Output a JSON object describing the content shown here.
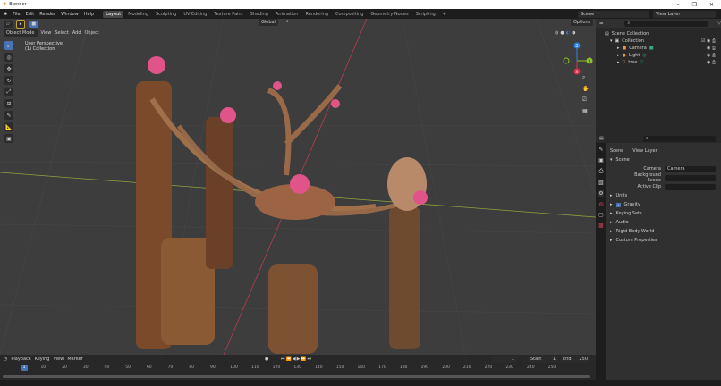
{
  "window": {
    "title": "Blender",
    "controls": [
      "–",
      "❐",
      "✕"
    ]
  },
  "menu": [
    "File",
    "Edit",
    "Render",
    "Window",
    "Help"
  ],
  "workspaces": [
    "Layout",
    "Modeling",
    "Sculpting",
    "UV Editing",
    "Texture Paint",
    "Shading",
    "Animation",
    "Rendering",
    "Compositing",
    "Geometry Nodes",
    "Scripting"
  ],
  "active_workspace": "Layout",
  "scene_selector": {
    "scene": "Scene",
    "view_layer": "View Layer"
  },
  "viewport": {
    "mode": "Object Mode",
    "menus": [
      "View",
      "Select",
      "Add",
      "Object"
    ],
    "orientation": "Global",
    "options": "Options",
    "overlay_text": [
      "User Perspective",
      "(1) Collection"
    ],
    "gizmo_axes": {
      "x": "X",
      "y": "Y",
      "z": "Z"
    }
  },
  "outliner": {
    "root": "Scene Collection",
    "collection": "Collection",
    "items": [
      "Camera",
      "Light",
      "tree"
    ]
  },
  "properties": {
    "tabs": [
      "Scene",
      "View Layer"
    ],
    "panel": "Scene",
    "camera_label": "Camera",
    "camera_value": "Camera",
    "background_scene_label": "Background Scene",
    "active_clip_label": "Active Clip",
    "sections": [
      "Units",
      "Gravity",
      "Keying Sets",
      "Audio",
      "Rigid Body World",
      "Custom Properties"
    ],
    "gravity_checked": true
  },
  "timeline": {
    "menus": [
      "Playback",
      "Keying",
      "View",
      "Marker"
    ],
    "current_frame": "1",
    "start_label": "Start",
    "start": "1",
    "end_label": "End",
    "end": "250",
    "ticks": [
      "1",
      "10",
      "20",
      "30",
      "40",
      "50",
      "60",
      "70",
      "80",
      "90",
      "100",
      "110",
      "120",
      "130",
      "140",
      "150",
      "160",
      "170",
      "180",
      "190",
      "200",
      "210",
      "220",
      "230",
      "240",
      "250"
    ]
  },
  "colors": {
    "accent": "#4772b3",
    "x_axis": "#d9324a",
    "y_axis": "#8ac427",
    "z_axis": "#2f83e0"
  }
}
